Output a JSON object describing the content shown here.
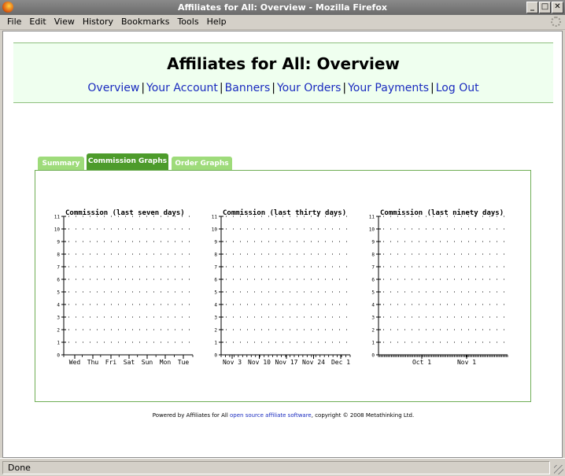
{
  "window": {
    "title": "Affiliates for All: Overview - Mozilla Firefox"
  },
  "menubar": [
    "File",
    "Edit",
    "View",
    "History",
    "Bookmarks",
    "Tools",
    "Help"
  ],
  "page": {
    "title": "Affiliates for All: Overview",
    "nav": [
      "Overview",
      "Your Account",
      "Banners",
      "Your Orders",
      "Your Payments",
      "Log Out"
    ],
    "tabs": [
      "Summary",
      "Commission Graphs",
      "Order Graphs"
    ],
    "active_tab": "Commission Graphs"
  },
  "chart_data": [
    {
      "type": "line",
      "title": "Commission (last seven days)",
      "categories": [
        "Wed",
        "Thu",
        "Fri",
        "Sat",
        "Sun",
        "Mon",
        "Tue"
      ],
      "ylim": [
        0,
        11
      ],
      "yticks": [
        "0",
        "1",
        "2",
        "3",
        "4",
        "5",
        "6",
        "7",
        "8",
        "9",
        "10",
        "11"
      ],
      "grid": true,
      "series": [
        {
          "values": [
            0,
            0,
            0,
            0,
            0,
            0,
            0
          ]
        }
      ]
    },
    {
      "type": "line",
      "title": "Commission (last thirty days)",
      "categories": [
        "Nov 3",
        "Nov 10",
        "Nov 17",
        "Nov 24",
        "Dec 1"
      ],
      "ylim": [
        0,
        11
      ],
      "yticks": [
        "0",
        "1",
        "2",
        "3",
        "4",
        "5",
        "6",
        "7",
        "8",
        "9",
        "10",
        "11"
      ],
      "grid": true,
      "series": [
        {
          "values": [
            0,
            0,
            0,
            0,
            0
          ]
        }
      ]
    },
    {
      "type": "line",
      "title": "Commission (last ninety days)",
      "categories": [
        "Oct 1",
        "Nov 1"
      ],
      "ylim": [
        0,
        11
      ],
      "yticks": [
        "0",
        "1",
        "2",
        "3",
        "4",
        "5",
        "6",
        "7",
        "8",
        "9",
        "10",
        "11"
      ],
      "grid": true,
      "series": [
        {
          "values": [
            0,
            0
          ]
        }
      ]
    }
  ],
  "footer": {
    "prefix": "Powered by Affiliates for All ",
    "link": "open source affiliate software",
    "suffix": ", copyright © 2008 Metathinking Ltd."
  },
  "status": {
    "text": "Done"
  }
}
